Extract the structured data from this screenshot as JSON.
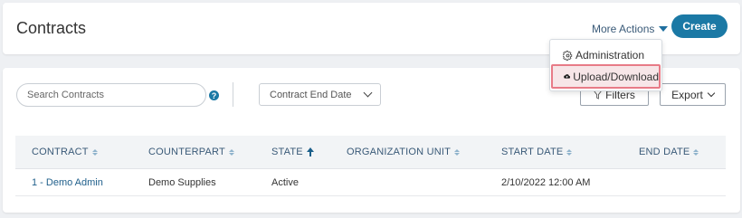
{
  "header": {
    "title": "Contracts",
    "more_actions_label": "More Actions",
    "create_label": "Create"
  },
  "dropdown": {
    "items": [
      {
        "label": "Administration",
        "icon": "gear-icon"
      },
      {
        "label": "Upload/Download",
        "icon": "cloud-upload-icon"
      }
    ]
  },
  "toolbar": {
    "search_placeholder": "Search Contracts",
    "search_value": "",
    "help_label": "?",
    "date_filter_selected": "Contract End Date",
    "filters_label": "Filters",
    "export_label": "Export"
  },
  "table": {
    "columns": [
      "CONTRACT",
      "COUNTERPART",
      "STATE",
      "ORGANIZATION UNIT",
      "START DATE",
      "END DATE"
    ],
    "sorted_column": "STATE",
    "sort_direction": "ascending",
    "rows": [
      {
        "contract": "1 - Demo Admin",
        "counterpart": "Demo Supplies",
        "state": "Active",
        "organization_unit": "",
        "start_date": "2/10/2022 12:00 AM",
        "end_date": ""
      }
    ]
  },
  "colors": {
    "primary": "#1b79a5",
    "link": "#1f5f8b",
    "highlight_border": "#e87b87",
    "background": "#eef0f3"
  }
}
